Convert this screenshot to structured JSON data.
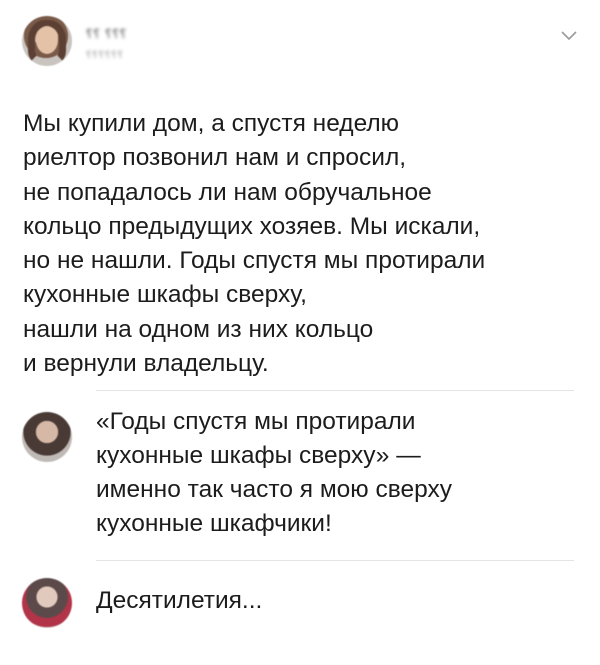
{
  "post": {
    "username": "⸮⸮ ⸮⸮⸮",
    "handle": "⸮⸮⸮⸮⸮⸮",
    "text_lines": [
      "Мы купили дом, а спустя неделю",
      "риелтор позвонил нам и спросил,",
      "не попадалось ли нам обручальное",
      "кольцо предыдущих хозяев. Мы искали,",
      "но не нашли. Годы спустя мы протирали",
      "кухонные шкафы сверху,",
      "нашли на одном из них кольцо",
      "и вернули владельцу."
    ],
    "menu_icon": "chevron-down-icon"
  },
  "comments": [
    {
      "avatar": "avatar",
      "text_lines": [
        "«Годы спустя мы протирали",
        "кухонные шкафы сверху» —",
        "именно так часто я мою сверху",
        "кухонные шкафчики!"
      ]
    },
    {
      "avatar": "avatar",
      "text_lines": [
        "Десятилетия..."
      ]
    }
  ],
  "colors": {
    "text": "#1c1c1c",
    "divider": "#e4e4e4",
    "background": "#ffffff"
  }
}
